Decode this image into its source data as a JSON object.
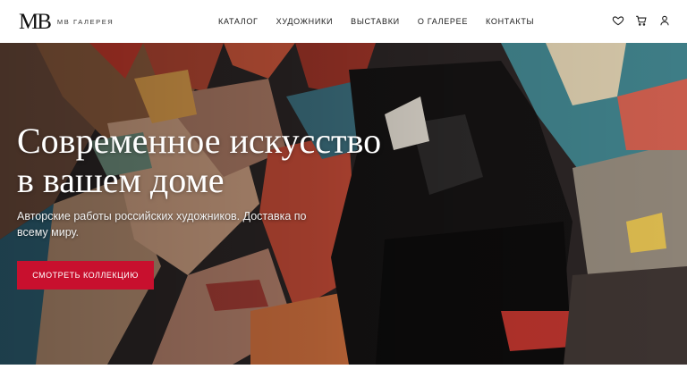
{
  "header": {
    "logo_mark": "MB",
    "logo_text": "MB ГАЛЕРЕЯ",
    "nav": [
      "КАТАЛОГ",
      "ХУДОЖНИКИ",
      "ВЫСТАВКИ",
      "О ГАЛЕРЕЕ",
      "КОНТАКТЫ"
    ],
    "icons": [
      "heart-icon",
      "cart-icon",
      "user-icon"
    ]
  },
  "hero": {
    "title_line1": "Современное искусство",
    "title_line2": "в вашем доме",
    "subtitle": "Авторские работы российских художников. Доставка по всему миру.",
    "cta_label": "СМОТРЕТЬ КОЛЛЕКЦИЮ"
  },
  "colors": {
    "accent": "#c8102e",
    "header_bg": "#ffffff",
    "text_dark": "#1a1a1a"
  }
}
